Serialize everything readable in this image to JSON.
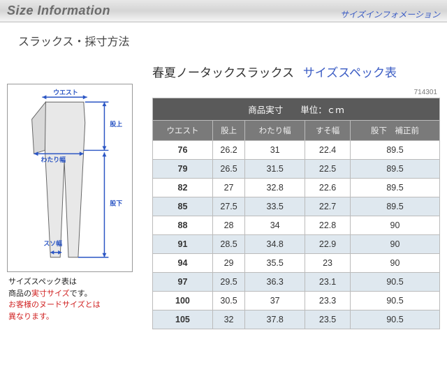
{
  "header": {
    "title": "Size Information",
    "sub": "サイズインフォメーション"
  },
  "subtitle": "スラックス・採寸方法",
  "product": {
    "name": "春夏ノータックスラックス",
    "spec_label": "サイズスペック表",
    "sku": "714301"
  },
  "diagram": {
    "labels": {
      "waist": "ウエスト",
      "rise": "股上",
      "thigh": "わたり幅",
      "inseam": "股下",
      "hem": "スソ幅"
    }
  },
  "notes": {
    "l1a": "サイズスペック表は",
    "l1b_pre": "商品の",
    "l1b_red": "実寸サイズ",
    "l1b_post": "です。",
    "l2": "お客様のヌードサイズとは",
    "l3": "異なります。"
  },
  "table": {
    "header_main": "商品実寸　　単位：ｃｍ",
    "cols": {
      "waist": "ウエスト",
      "rise": "股上",
      "thigh": "わたり幅",
      "hem": "すそ幅",
      "inseam": "股下　補正前"
    },
    "rows": [
      {
        "waist": "76",
        "rise": "26.2",
        "thigh": "31",
        "hem": "22.4",
        "inseam": "89.5"
      },
      {
        "waist": "79",
        "rise": "26.5",
        "thigh": "31.5",
        "hem": "22.5",
        "inseam": "89.5"
      },
      {
        "waist": "82",
        "rise": "27",
        "thigh": "32.8",
        "hem": "22.6",
        "inseam": "89.5"
      },
      {
        "waist": "85",
        "rise": "27.5",
        "thigh": "33.5",
        "hem": "22.7",
        "inseam": "89.5"
      },
      {
        "waist": "88",
        "rise": "28",
        "thigh": "34",
        "hem": "22.8",
        "inseam": "90"
      },
      {
        "waist": "91",
        "rise": "28.5",
        "thigh": "34.8",
        "hem": "22.9",
        "inseam": "90"
      },
      {
        "waist": "94",
        "rise": "29",
        "thigh": "35.5",
        "hem": "23",
        "inseam": "90"
      },
      {
        "waist": "97",
        "rise": "29.5",
        "thigh": "36.3",
        "hem": "23.1",
        "inseam": "90.5"
      },
      {
        "waist": "100",
        "rise": "30.5",
        "thigh": "37",
        "hem": "23.3",
        "inseam": "90.5"
      },
      {
        "waist": "105",
        "rise": "32",
        "thigh": "37.8",
        "hem": "23.5",
        "inseam": "90.5"
      }
    ]
  }
}
